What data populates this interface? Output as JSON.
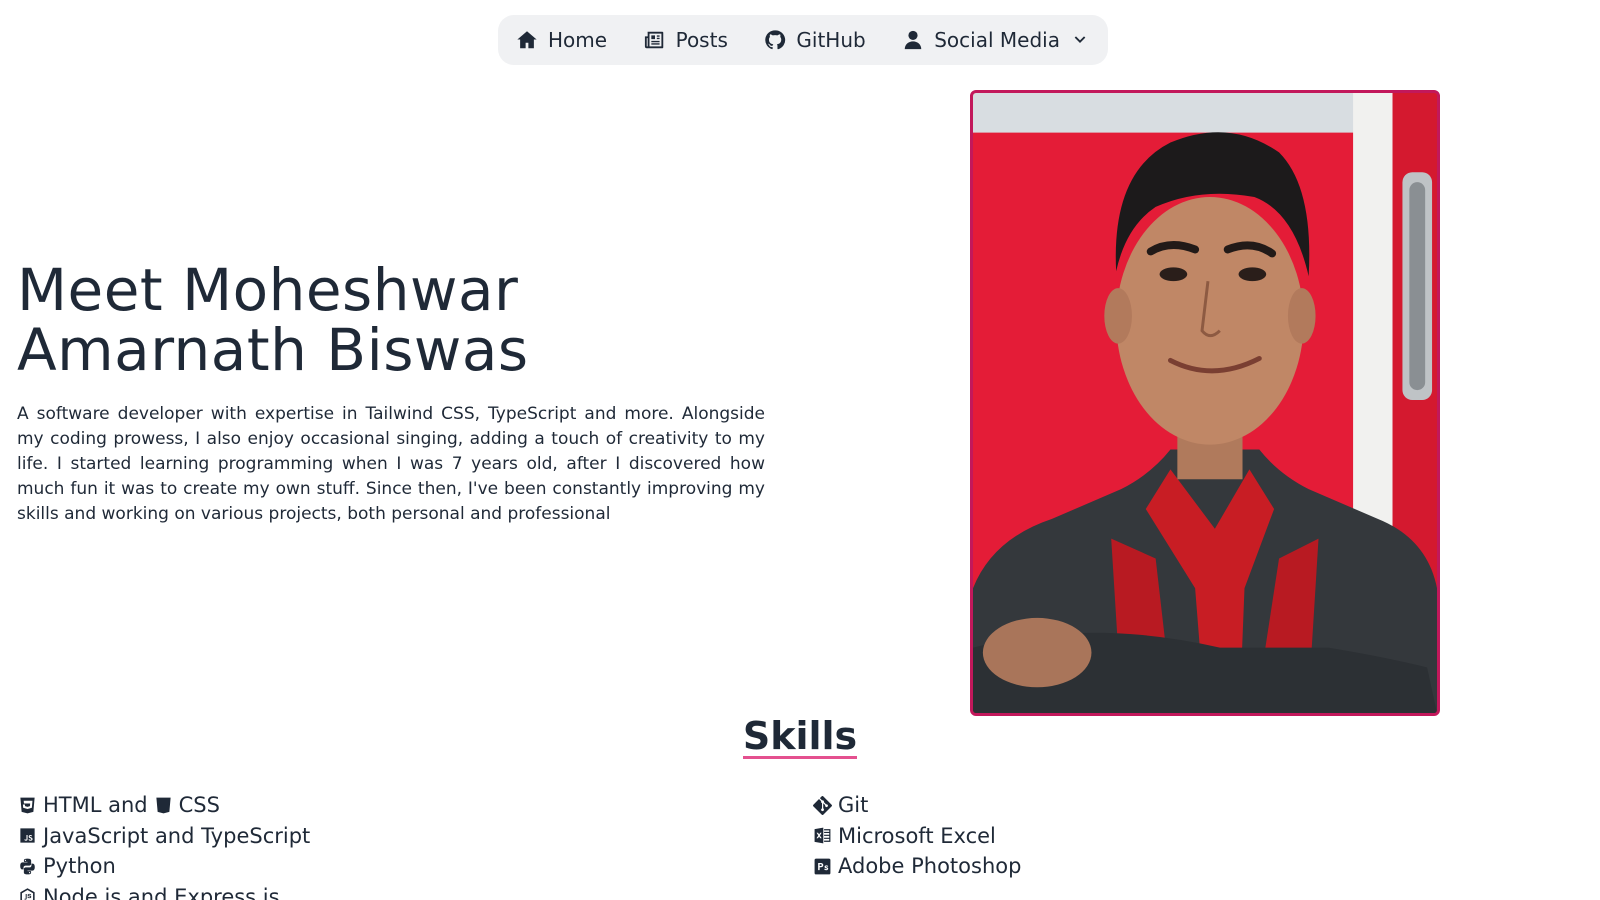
{
  "nav": {
    "items": [
      {
        "label": "Home",
        "icon": "home-icon"
      },
      {
        "label": "Posts",
        "icon": "newspaper-icon"
      },
      {
        "label": "GitHub",
        "icon": "github-icon"
      },
      {
        "label": "Social Media",
        "icon": "user-icon"
      }
    ]
  },
  "hero": {
    "title_line1": "Meet Moheshwar",
    "title_line2": "Amarnath Biswas",
    "description": "A software developer with expertise in Tailwind CSS, TypeScript and more. Alongside my coding prowess, I also enjoy occasional singing, adding a touch of creativity to my life. I started learning programming when I was 7 years old, after I discovered how much fun it was to create my own stuff. Since then, I've been constantly improving my skills and working on various projects, both personal and professional",
    "photo_border_color": "#c2185b"
  },
  "skills": {
    "title": "Skills",
    "underline_color": "#e4508f",
    "left": [
      {
        "label_a": "HTML and",
        "label_b": "CSS"
      },
      {
        "label": "JavaScript and TypeScript"
      },
      {
        "label": "Python"
      },
      {
        "label": "Node.js and Express.js"
      }
    ],
    "right": [
      {
        "label": "Git"
      },
      {
        "label": "Microsoft Excel"
      },
      {
        "label": "Adobe Photoshop"
      }
    ]
  }
}
